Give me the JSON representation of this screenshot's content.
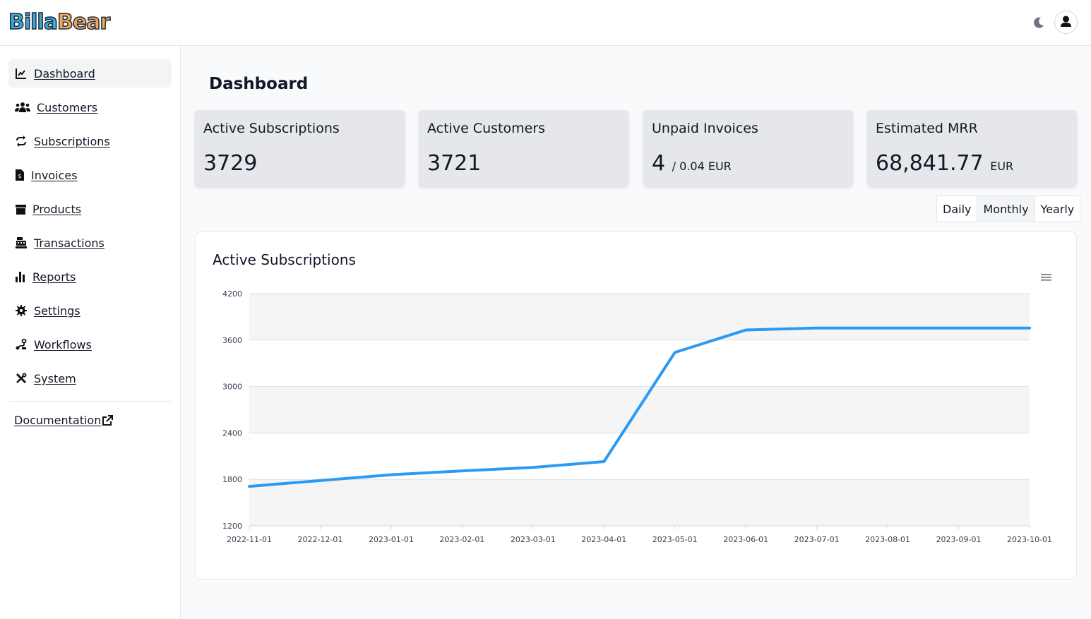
{
  "app": {
    "logo_part1": "Billa",
    "logo_part2": "Bear"
  },
  "header": {
    "theme_icon": "moon-icon",
    "avatar_icon": "user-icon"
  },
  "sidebar": {
    "items": [
      {
        "label": "Dashboard",
        "icon": "chart-line-icon",
        "active": true
      },
      {
        "label": "Customers",
        "icon": "users-icon"
      },
      {
        "label": "Subscriptions",
        "icon": "repeat-icon"
      },
      {
        "label": "Invoices",
        "icon": "invoice-icon"
      },
      {
        "label": "Products",
        "icon": "box-icon"
      },
      {
        "label": "Transactions",
        "icon": "cash-register-icon"
      },
      {
        "label": "Reports",
        "icon": "bar-chart-icon"
      },
      {
        "label": "Settings",
        "icon": "gear-icon"
      },
      {
        "label": "Workflows",
        "icon": "workflow-icon"
      },
      {
        "label": "System",
        "icon": "tools-icon"
      }
    ],
    "documentation": "Documentation"
  },
  "main": {
    "title": "Dashboard",
    "stats": [
      {
        "title": "Active Subscriptions",
        "value": "3729",
        "unit": ""
      },
      {
        "title": "Active Customers",
        "value": "3721",
        "unit": ""
      },
      {
        "title": "Unpaid Invoices",
        "value": "4",
        "unit": "/ 0.04 EUR"
      },
      {
        "title": "Estimated MRR",
        "value": "68,841.77",
        "unit": "EUR"
      }
    ],
    "period_options": [
      "Daily",
      "Monthly",
      "Yearly"
    ],
    "period_selected": "Monthly"
  },
  "chart_data": {
    "type": "line",
    "title": "Active Subscriptions",
    "x": [
      "2022-11-01",
      "2022-12-01",
      "2023-01-01",
      "2023-02-01",
      "2023-03-01",
      "2023-04-01",
      "2023-05-01",
      "2023-06-01",
      "2023-07-01",
      "2023-08-01",
      "2023-09-01",
      "2023-10-01"
    ],
    "series": [
      {
        "values": [
          1710,
          1785,
          1860,
          1910,
          1955,
          2030,
          3440,
          3730,
          3755,
          3755,
          3755,
          3755
        ]
      }
    ],
    "yticks": [
      1200,
      1800,
      2400,
      3000,
      3600,
      4200
    ],
    "ylim": [
      1200,
      4200
    ],
    "color": "#2b9af3",
    "grid": true,
    "legend": "none"
  }
}
